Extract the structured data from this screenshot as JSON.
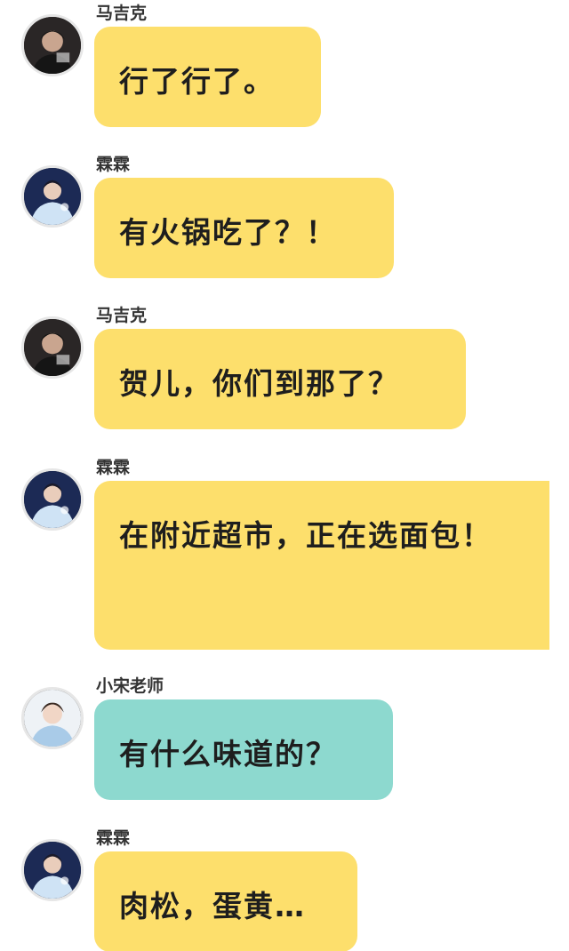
{
  "colors": {
    "yellow_bubble": "#fddf6c",
    "teal_bubble": "#8dd9cf",
    "avatar_ring": "#e6e6e6"
  },
  "messages": [
    {
      "sender": "马吉克",
      "text": "行了行了。",
      "bubble_color": "yellow",
      "avatar": "dark-avatar-icon"
    },
    {
      "sender": "霖霖",
      "text": "有火锅吃了？！",
      "bubble_color": "yellow",
      "avatar": "blue-avatar-icon"
    },
    {
      "sender": "马吉克",
      "text": "贺儿，你们到那了？",
      "bubble_color": "yellow",
      "avatar": "dark-avatar-icon"
    },
    {
      "sender": "霖霖",
      "text": "在附近超市，正在选面包！",
      "bubble_color": "yellow",
      "avatar": "blue-avatar-icon"
    },
    {
      "sender": "小宋老师",
      "text": "有什么味道的？",
      "bubble_color": "teal",
      "avatar": "light-avatar-icon"
    },
    {
      "sender": "霖霖",
      "text": "肉松，蛋黄…",
      "bubble_color": "yellow",
      "avatar": "blue-avatar-icon"
    }
  ]
}
